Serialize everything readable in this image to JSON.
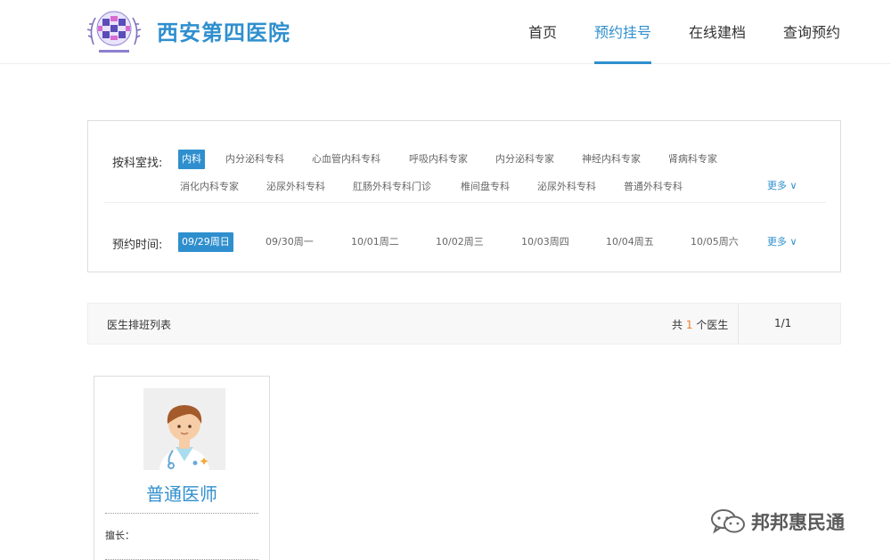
{
  "header": {
    "site_name": "西安第四医院",
    "nav": [
      "首页",
      "预约挂号",
      "在线建档",
      "查询预约"
    ],
    "active_index": 1
  },
  "filters": {
    "department_label": "按科室找:",
    "departments_row1": [
      "内科",
      "内分泌科专科",
      "心血管内科专科",
      "呼吸内科专家",
      "内分泌科专家",
      "神经内科专家",
      "肾病科专家"
    ],
    "departments_row2": [
      "消化内科专家",
      "泌尿外科专科",
      "肛肠外科专科门诊",
      "椎间盘专科",
      "泌尿外科专科",
      "普通外科专科"
    ],
    "selected_department": "内科",
    "more_label": "更多 ∨",
    "time_label": "预约时间:",
    "dates": [
      "09/29周日",
      "09/30周一",
      "10/01周二",
      "10/02周三",
      "10/03周四",
      "10/04周五",
      "10/05周六"
    ],
    "selected_date": "09/29周日"
  },
  "list": {
    "title": "医生排班列表",
    "count_prefix": "共",
    "count": "1",
    "count_suffix": "个医生",
    "pager": "1/1"
  },
  "doctors": [
    {
      "name": "普通医师",
      "specialty_label": "擅长：",
      "avatar_icon": "doctor-avatar-icon"
    }
  ],
  "watermark": {
    "text": "邦邦惠民通",
    "icon": "wechat-icon"
  },
  "colors": {
    "accent": "#2f8fce",
    "count_highlight": "#f07c2b"
  }
}
